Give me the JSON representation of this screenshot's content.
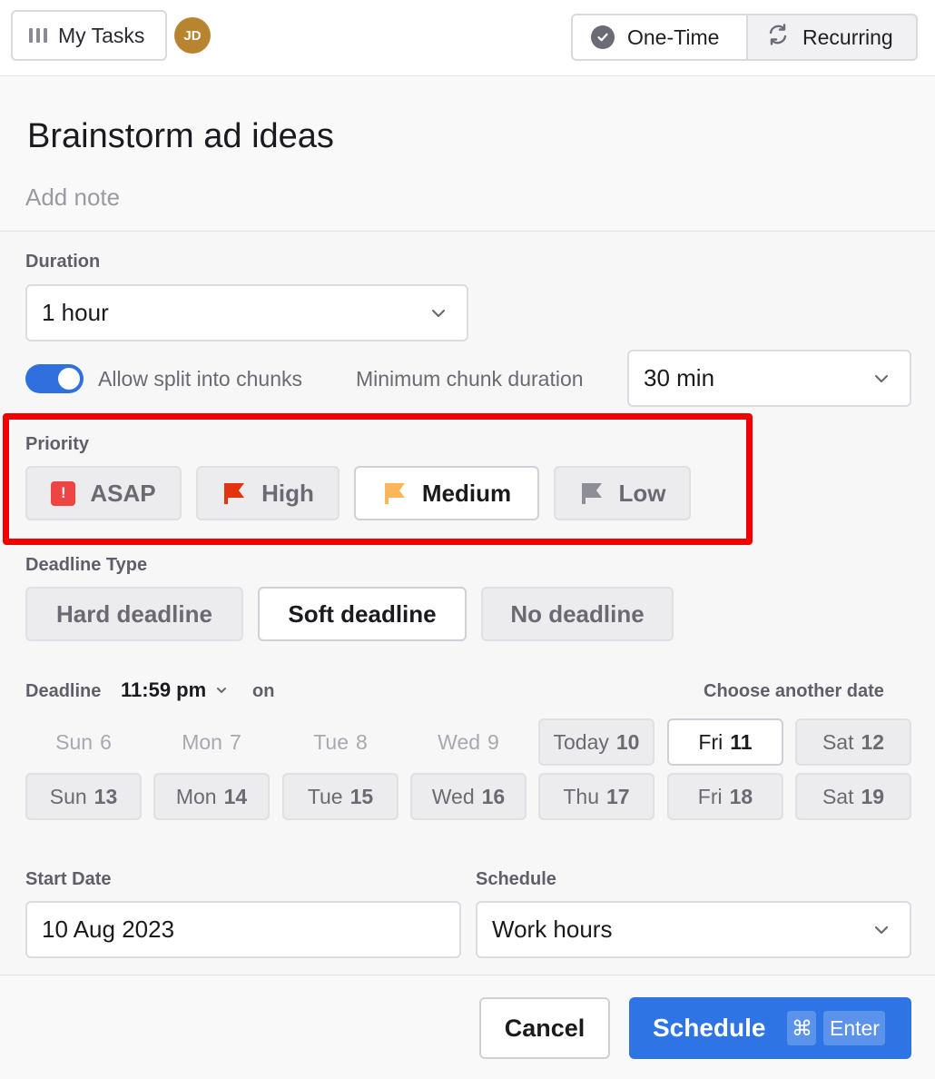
{
  "header": {
    "my_tasks_label": "My Tasks",
    "avatar_initials": "JD",
    "avatar_color": "#b8842f",
    "task_type_tabs": [
      {
        "label": "One-Time",
        "icon": "check-circle-icon",
        "selected": true
      },
      {
        "label": "Recurring",
        "icon": "recurring-arrows-icon",
        "selected": false
      }
    ]
  },
  "task": {
    "title": "Brainstorm ad ideas",
    "note_placeholder": "Add note"
  },
  "duration": {
    "label": "Duration",
    "value": "1 hour",
    "allow_split_on": true,
    "allow_split_label": "Allow split into chunks",
    "min_chunk_label": "Minimum chunk duration",
    "min_chunk_value": "30 min"
  },
  "priority": {
    "label": "Priority",
    "options": [
      {
        "label": "ASAP",
        "icon": "exclamation-square-icon",
        "color": "#ef4444",
        "selected": false
      },
      {
        "label": "High",
        "icon": "flag-icon",
        "color": "#e3340f",
        "selected": false
      },
      {
        "label": "Medium",
        "icon": "flag-icon",
        "color": "#fbb65a",
        "selected": true
      },
      {
        "label": "Low",
        "icon": "flag-icon",
        "color": "#8e8e96",
        "selected": false
      }
    ],
    "highlight_color": "#f20000"
  },
  "deadline_type": {
    "label": "Deadline Type",
    "options": [
      {
        "label": "Hard deadline",
        "selected": false
      },
      {
        "label": "Soft deadline",
        "selected": true
      },
      {
        "label": "No deadline",
        "selected": false
      }
    ]
  },
  "deadline": {
    "label": "Deadline",
    "time": "11:59 pm",
    "on_label": "on",
    "choose_other_label": "Choose another date",
    "days": [
      {
        "day": "Sun",
        "num": "6",
        "state": "past"
      },
      {
        "day": "Mon",
        "num": "7",
        "state": "past"
      },
      {
        "day": "Tue",
        "num": "8",
        "state": "past"
      },
      {
        "day": "Wed",
        "num": "9",
        "state": "past"
      },
      {
        "day": "Today",
        "num": "10",
        "state": "normal"
      },
      {
        "day": "Fri",
        "num": "11",
        "state": "selected"
      },
      {
        "day": "Sat",
        "num": "12",
        "state": "normal"
      },
      {
        "day": "Sun",
        "num": "13",
        "state": "normal"
      },
      {
        "day": "Mon",
        "num": "14",
        "state": "normal"
      },
      {
        "day": "Tue",
        "num": "15",
        "state": "normal"
      },
      {
        "day": "Wed",
        "num": "16",
        "state": "normal"
      },
      {
        "day": "Thu",
        "num": "17",
        "state": "normal"
      },
      {
        "day": "Fri",
        "num": "18",
        "state": "normal"
      },
      {
        "day": "Sat",
        "num": "19",
        "state": "normal"
      }
    ]
  },
  "start_date": {
    "label": "Start Date",
    "value": "10 Aug 2023"
  },
  "schedule": {
    "label": "Schedule",
    "value": "Work hours"
  },
  "footer": {
    "cancel_label": "Cancel",
    "schedule_label": "Schedule",
    "shortcut_cmd": "⌘",
    "shortcut_key": "Enter",
    "primary_color": "#2e74e4"
  }
}
